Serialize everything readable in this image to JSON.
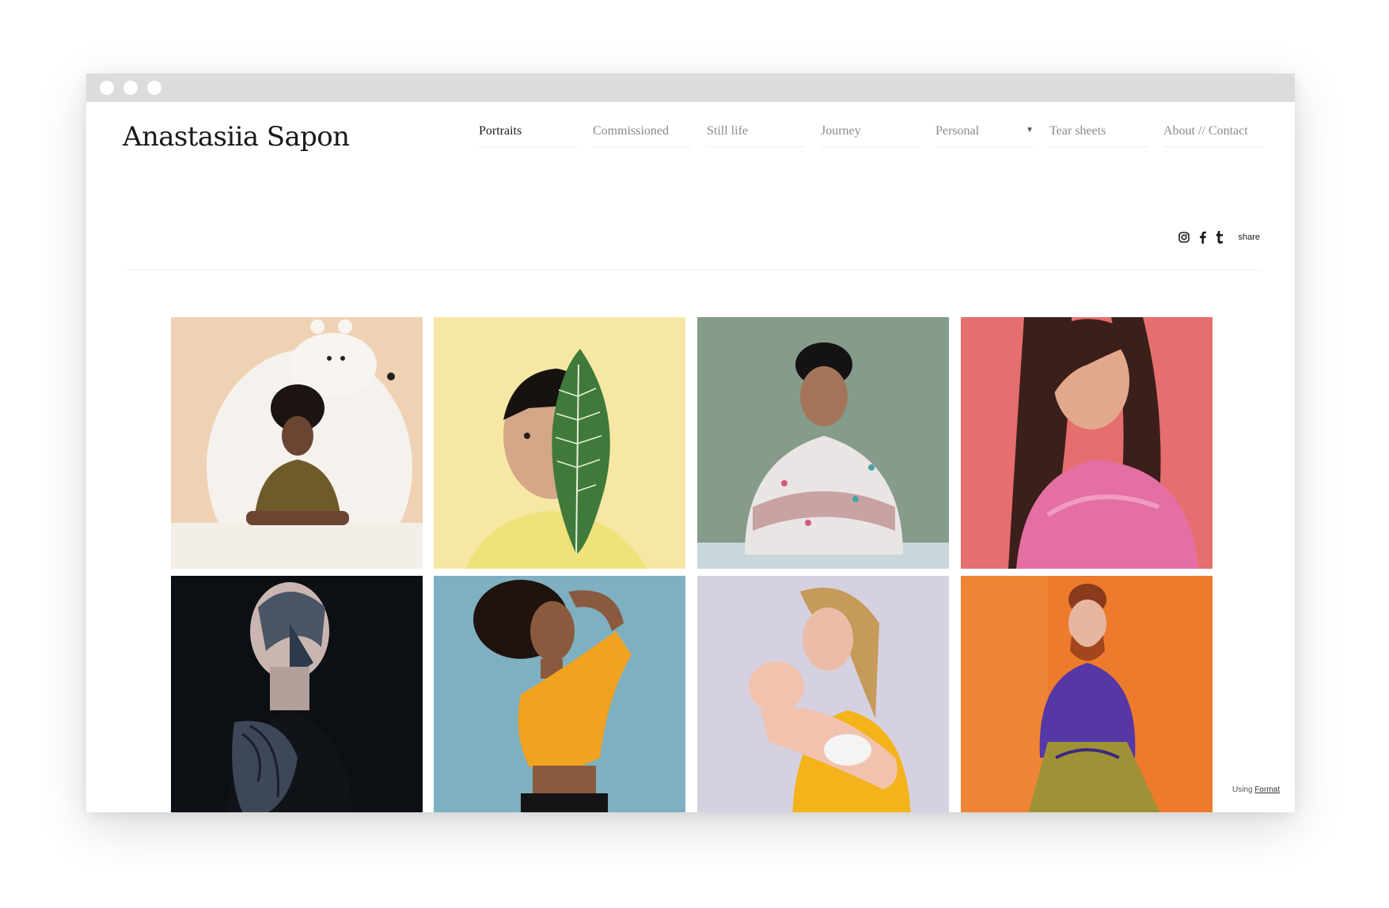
{
  "site": {
    "title": "Anastasiia Sapon"
  },
  "nav": [
    {
      "label": "Portraits",
      "active": true
    },
    {
      "label": "Commissioned"
    },
    {
      "label": "Still life"
    },
    {
      "label": "Journey"
    },
    {
      "label": "Personal",
      "dropdown": true
    },
    {
      "label": "Tear sheets"
    },
    {
      "label": "About // Contact"
    }
  ],
  "social": {
    "icons": [
      "instagram-icon",
      "facebook-icon",
      "tumblr-icon"
    ],
    "share_label": "share"
  },
  "gallery": {
    "photos": [
      {
        "name": "photo-bear-portrait",
        "bg": "#efd2b4"
      },
      {
        "name": "photo-leaf-portrait",
        "bg": "#f6e7a4"
      },
      {
        "name": "photo-arms-crossed-portrait",
        "bg": "#869c8a"
      },
      {
        "name": "photo-pink-fur-portrait",
        "bg": "#e66e6f"
      },
      {
        "name": "photo-tattoo-portrait",
        "bg": "#0c0f14"
      },
      {
        "name": "photo-yellow-top-portrait",
        "bg": "#7fb0c1"
      },
      {
        "name": "photo-mother-baby-portrait",
        "bg": "#d6d1e0"
      },
      {
        "name": "photo-purple-shirt-portrait",
        "bg": "#ee7a2c"
      }
    ]
  },
  "footer": {
    "using_label": "Using",
    "format_link": "Format"
  }
}
